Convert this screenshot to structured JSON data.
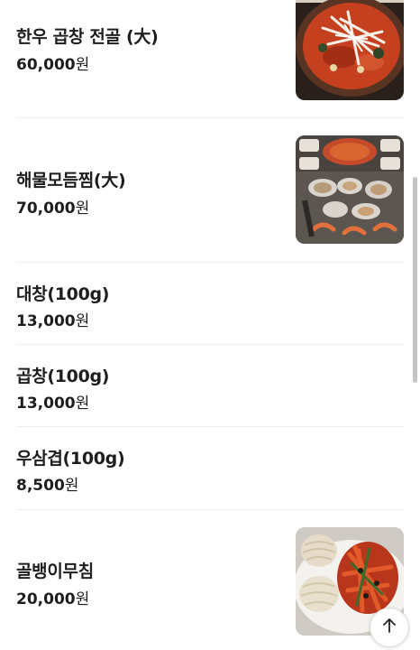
{
  "menu": {
    "items": [
      {
        "name": "한우 곱창 전골 (大)",
        "price": "60,000",
        "currency": "원",
        "photo": "beef-tripe-hotpot-photo"
      },
      {
        "name": "해물모듬찜(大)",
        "price": "70,000",
        "currency": "원",
        "photo": "seafood-platter-photo"
      },
      {
        "name": "대창(100g)",
        "price": "13,000",
        "currency": "원"
      },
      {
        "name": "곱창(100g)",
        "price": "13,000",
        "currency": "원"
      },
      {
        "name": "우삼겹(100g)",
        "price": "8,500",
        "currency": "원"
      },
      {
        "name": "골뱅이무침",
        "price": "20,000",
        "currency": "원",
        "photo": "sea-snail-salad-photo"
      }
    ]
  },
  "icons": {
    "scroll_top": "arrow-up-icon"
  },
  "colors": {
    "text": "#1e1e1e",
    "divider": "#eeeeee"
  }
}
